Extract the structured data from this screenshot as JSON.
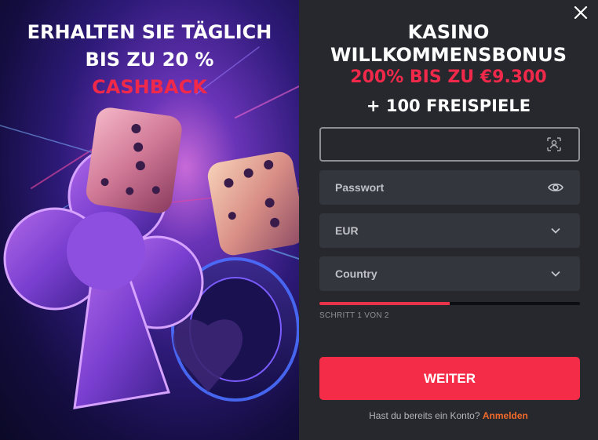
{
  "promo": {
    "headline_line1": "ERHALTEN SIE TÄGLICH",
    "headline_line2": "BIS ZU 20 %",
    "headline_accent": "CASHBACK"
  },
  "bonus": {
    "line1": "KASINO",
    "line2": "WILLKOMMENSBONUS",
    "line3": "200% BIS ZU €9.300",
    "line4": "+ 100 FREISPIELE"
  },
  "form": {
    "username_value": "",
    "password_label": "Passwort",
    "currency_value": "EUR",
    "country_label": "Country",
    "progress_fraction": 0.5,
    "step_text": "SCHRITT 1 VON 2",
    "submit_label": "WEITER",
    "login_prompt": "Hast du bereits ein Konto?",
    "login_link": "Anmelden"
  },
  "icons": {
    "close": "close-icon",
    "username": "user-scan-icon",
    "password": "eye-icon",
    "dropdown": "chevron-down-icon"
  },
  "colors": {
    "accent": "#f52c48",
    "accent_text": "#f0294a",
    "link": "#f26a2a",
    "panel_bg": "#26282e",
    "field_bg": "#34363d"
  }
}
